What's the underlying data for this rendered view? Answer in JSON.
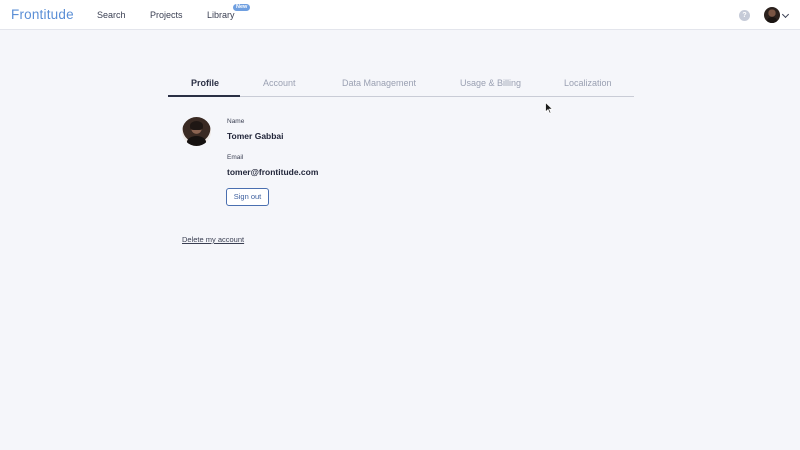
{
  "app": {
    "logo": "Frontitude"
  },
  "nav": {
    "items": [
      {
        "label": "Search"
      },
      {
        "label": "Projects"
      },
      {
        "label": "Library"
      }
    ],
    "library_badge": "New",
    "help_glyph": "?"
  },
  "settings": {
    "tabs": [
      {
        "label": "Profile",
        "active": true
      },
      {
        "label": "Account",
        "active": false
      },
      {
        "label": "Data Management",
        "active": false
      },
      {
        "label": "Usage & Billing",
        "active": false
      },
      {
        "label": "Localization",
        "active": false
      }
    ]
  },
  "profile": {
    "name_label": "Name",
    "name": "Tomer Gabbai",
    "email_label": "Email",
    "email": "tomer@frontitude.com",
    "signout_label": "Sign out",
    "delete_label": "Delete my account"
  },
  "colors": {
    "brand": "#5b8fd6",
    "accent": "#4a6fb0",
    "background": "#f5f6fa"
  },
  "icons": {
    "help": "help-icon",
    "chevron": "chevron-down-icon",
    "cursor": "cursor-icon"
  }
}
